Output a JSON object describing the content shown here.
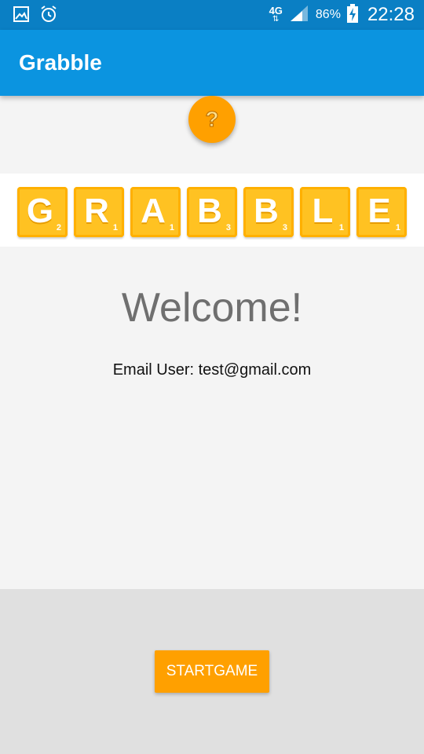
{
  "status_bar": {
    "network": "4G",
    "battery": "86%",
    "time": "22:28"
  },
  "app_bar": {
    "title": "Grabble"
  },
  "help_button": {
    "symbol": "?"
  },
  "logo": {
    "tiles": [
      {
        "letter": "G",
        "score": "2"
      },
      {
        "letter": "R",
        "score": "1"
      },
      {
        "letter": "A",
        "score": "1"
      },
      {
        "letter": "B",
        "score": "3"
      },
      {
        "letter": "B",
        "score": "3"
      },
      {
        "letter": "L",
        "score": "1"
      },
      {
        "letter": "E",
        "score": "1"
      }
    ]
  },
  "main": {
    "welcome": "Welcome!",
    "email_line": "Email User: test@gmail.com"
  },
  "actions": {
    "start_label": "STARTGAME"
  },
  "colors": {
    "status_bar": "#0a7fc4",
    "app_bar": "#0b94e0",
    "accent": "#ffa000",
    "tile": "#ffc222"
  }
}
